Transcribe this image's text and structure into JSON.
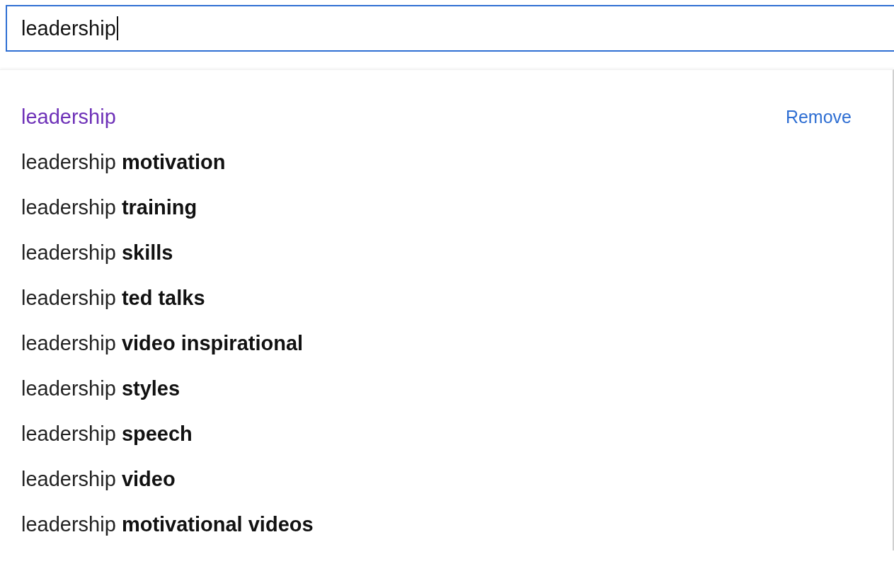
{
  "search": {
    "value": "leadership",
    "focused": true
  },
  "suggestions": [
    {
      "kind": "history",
      "text": "leadership",
      "action": "Remove"
    },
    {
      "kind": "suggestion",
      "text": "leadership **motivation**"
    },
    {
      "kind": "suggestion",
      "text": "leadership **training**"
    },
    {
      "kind": "suggestion",
      "text": "leadership **skills**"
    },
    {
      "kind": "suggestion",
      "text": "leadership **ted talks**"
    },
    {
      "kind": "suggestion",
      "text": "leadership **video inspirational**"
    },
    {
      "kind": "suggestion",
      "text": "leadership **styles**"
    },
    {
      "kind": "suggestion",
      "text": "leadership **speech**"
    },
    {
      "kind": "suggestion",
      "text": "leadership **video**"
    },
    {
      "kind": "suggestion",
      "text": "leadership **motivational videos**"
    }
  ]
}
